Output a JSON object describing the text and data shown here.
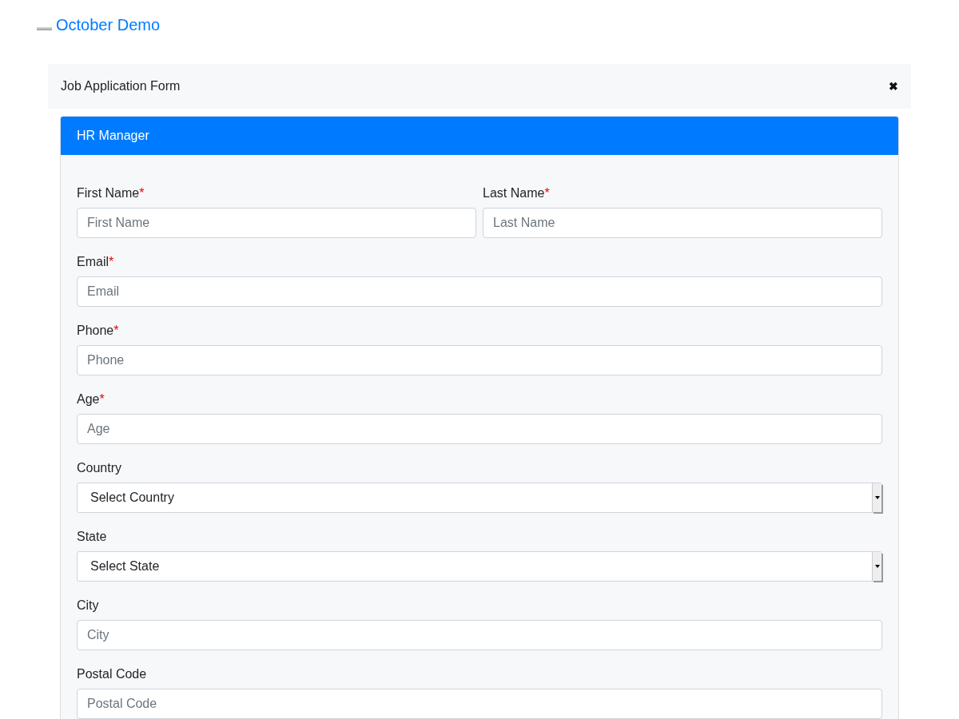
{
  "brand": {
    "title": "October Demo"
  },
  "panel": {
    "title": "Job Application Form",
    "close": "✖"
  },
  "card": {
    "header": "HR Manager",
    "required_mark": "*"
  },
  "rows": [
    [
      {
        "kind": "text",
        "label": "First Name",
        "required": true,
        "placeholder": "First Name"
      },
      {
        "kind": "text",
        "label": "Last Name",
        "required": true,
        "placeholder": "Last Name"
      }
    ],
    [
      {
        "kind": "text",
        "label": "Email",
        "required": true,
        "placeholder": "Email"
      }
    ],
    [
      {
        "kind": "text",
        "label": "Phone",
        "required": true,
        "placeholder": "Phone"
      }
    ],
    [
      {
        "kind": "text",
        "label": "Age",
        "required": true,
        "placeholder": "Age"
      }
    ],
    [
      {
        "kind": "select",
        "label": "Country",
        "required": false,
        "value": "Select Country"
      }
    ],
    [
      {
        "kind": "select",
        "label": "State",
        "required": false,
        "value": "Select State"
      }
    ],
    [
      {
        "kind": "text",
        "label": "City",
        "required": false,
        "placeholder": "City"
      }
    ],
    [
      {
        "kind": "text",
        "label": "Postal Code",
        "required": false,
        "placeholder": "Postal Code"
      }
    ]
  ]
}
